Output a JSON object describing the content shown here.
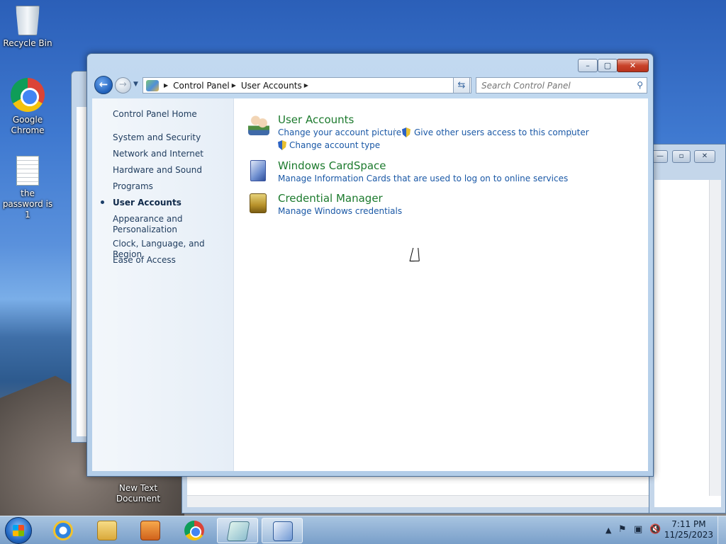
{
  "desktop": {
    "icons": [
      {
        "label": "Recycle Bin",
        "icon": "recycle-bin-icon"
      },
      {
        "label": "Google Chrome",
        "icon": "chrome-icon"
      },
      {
        "label": "the password is 1",
        "icon": "text-file-icon"
      },
      {
        "label": "New Text Document",
        "icon": "text-file-icon"
      }
    ]
  },
  "window": {
    "address": {
      "crumbs": [
        "Control Panel",
        "User Accounts"
      ]
    },
    "search": {
      "placeholder": "Search Control Panel"
    },
    "left_nav": {
      "home": "Control Panel Home",
      "items": [
        "System and Security",
        "Network and Internet",
        "Hardware and Sound",
        "Programs",
        "User Accounts",
        "Appearance and Personalization",
        "Clock, Language, and Region",
        "Ease of Access"
      ],
      "active_index": 4
    },
    "categories": [
      {
        "title": "User Accounts",
        "icon": "user-accounts-icon",
        "links": [
          "Change your account picture",
          "Give other users access to this computer",
          "Change account type"
        ]
      },
      {
        "title": "Windows CardSpace",
        "icon": "cardspace-icon",
        "links": [
          "Manage Information Cards that are used to log on to online services"
        ]
      },
      {
        "title": "Credential Manager",
        "icon": "credential-manager-icon",
        "links": [
          "Manage Windows credentials"
        ]
      }
    ]
  },
  "taskbar": {
    "apps": [
      "start-orb",
      "internet-explorer-icon",
      "windows-explorer-icon",
      "media-player-icon",
      "chrome-icon",
      "notepad-icon",
      "control-panel-icon"
    ],
    "clock": {
      "time": "7:11 PM",
      "date": "11/25/2023"
    }
  },
  "colors": {
    "category_title": "#1c7a2d",
    "link": "#1a58a6",
    "nav_text": "#1e3b5d"
  }
}
